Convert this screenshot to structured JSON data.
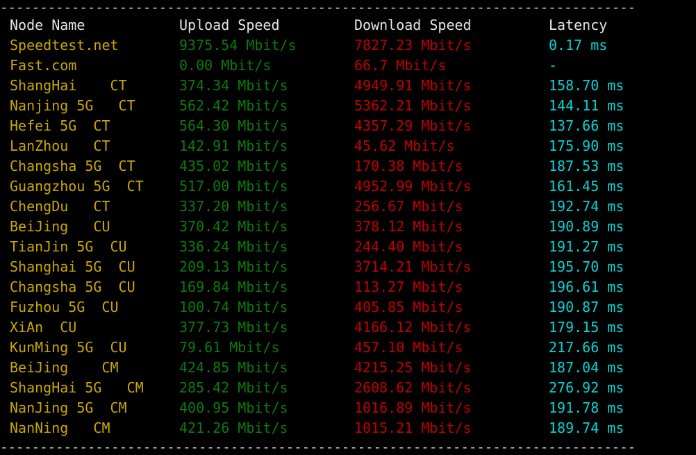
{
  "terminal": {
    "background": "#000000",
    "separator_char": "-",
    "separator_text": "--------------------------------------------------------------------------------",
    "colors": {
      "header": "#e6e6e6",
      "node_name": "#c9a800",
      "upload": "#0c7a0c",
      "download": "#c00000",
      "latency": "#00d7d7",
      "separator": "#d8d8d8"
    }
  },
  "table": {
    "headers": {
      "node": "Node Name",
      "upload": "Upload Speed",
      "download": "Download Speed",
      "latency": "Latency"
    },
    "rows": [
      {
        "node": "Speedtest.net",
        "upload": "9375.54 Mbit/s",
        "download": "7827.23 Mbit/s",
        "latency": "0.17 ms"
      },
      {
        "node": "Fast.com",
        "upload": "0.00 Mbit/s",
        "download": "66.7 Mbit/s",
        "latency": "-"
      },
      {
        "node": "ShangHai    CT",
        "upload": "374.34 Mbit/s",
        "download": "4949.91 Mbit/s",
        "latency": "158.70 ms"
      },
      {
        "node": "Nanjing 5G   CT",
        "upload": "562.42 Mbit/s",
        "download": "5362.21 Mbit/s",
        "latency": "144.11 ms"
      },
      {
        "node": "Hefei 5G  CT",
        "upload": "564.30 Mbit/s",
        "download": "4357.29 Mbit/s",
        "latency": "137.66 ms"
      },
      {
        "node": "LanZhou   CT",
        "upload": "142.91 Mbit/s",
        "download": "45.62 Mbit/s",
        "latency": "175.90 ms"
      },
      {
        "node": "Changsha 5G  CT",
        "upload": "435.02 Mbit/s",
        "download": "170.38 Mbit/s",
        "latency": "187.53 ms"
      },
      {
        "node": "Guangzhou 5G  CT",
        "upload": "517.00 Mbit/s",
        "download": "4952.99 Mbit/s",
        "latency": "161.45 ms"
      },
      {
        "node": "ChengDu   CT",
        "upload": "337.20 Mbit/s",
        "download": "256.67 Mbit/s",
        "latency": "192.74 ms"
      },
      {
        "node": "BeiJing   CU",
        "upload": "370.42 Mbit/s",
        "download": "378.12 Mbit/s",
        "latency": "190.89 ms"
      },
      {
        "node": "TianJin 5G  CU",
        "upload": "336.24 Mbit/s",
        "download": "244.40 Mbit/s",
        "latency": "191.27 ms"
      },
      {
        "node": "Shanghai 5G  CU",
        "upload": "209.13 Mbit/s",
        "download": "3714.21 Mbit/s",
        "latency": "195.70 ms"
      },
      {
        "node": "Changsha 5G  CU",
        "upload": "169.84 Mbit/s",
        "download": "113.27 Mbit/s",
        "latency": "196.61 ms"
      },
      {
        "node": "Fuzhou 5G  CU",
        "upload": "100.74 Mbit/s",
        "download": "405.85 Mbit/s",
        "latency": "190.87 ms"
      },
      {
        "node": "XiAn  CU",
        "upload": "377.73 Mbit/s",
        "download": "4166.12 Mbit/s",
        "latency": "179.15 ms"
      },
      {
        "node": "KunMing 5G  CU",
        "upload": "79.61 Mbit/s",
        "download": "457.10 Mbit/s",
        "latency": "217.66 ms"
      },
      {
        "node": "BeiJing    CM",
        "upload": "424.85 Mbit/s",
        "download": "4215.25 Mbit/s",
        "latency": "187.04 ms"
      },
      {
        "node": "ShangHai 5G   CM",
        "upload": "285.42 Mbit/s",
        "download": "2608.62 Mbit/s",
        "latency": "276.92 ms"
      },
      {
        "node": "NanJing 5G  CM",
        "upload": "400.95 Mbit/s",
        "download": "1016.89 Mbit/s",
        "latency": "191.78 ms"
      },
      {
        "node": "NanNing   CM",
        "upload": "421.26 Mbit/s",
        "download": "1015.21 Mbit/s",
        "latency": "189.74 ms"
      }
    ]
  }
}
